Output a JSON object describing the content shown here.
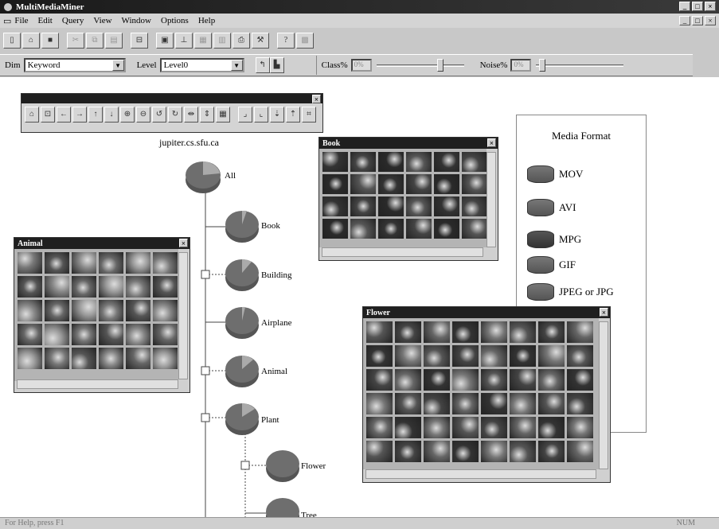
{
  "window": {
    "title": "MultiMediaMiner"
  },
  "menu": [
    "File",
    "Edit",
    "Query",
    "View",
    "Window",
    "Options",
    "Help"
  ],
  "toolbar_icons": [
    "new-icon",
    "open-icon",
    "save-icon",
    "cut-icon",
    "copy-icon",
    "paste-icon",
    "print-preview-icon",
    "frame-icon",
    "align-icon",
    "table-icon",
    "chart-icon",
    "printer-icon",
    "tool-icon",
    "help-icon",
    "grid-icon"
  ],
  "dimbar": {
    "dim_label": "Dim",
    "dim_value": "Keyword",
    "level_label": "Level",
    "level_value": "Level0",
    "class_label": "Class%",
    "class_value": "0%",
    "noise_label": "Noise%",
    "noise_value": "0%"
  },
  "tree": {
    "host": "jupiter.cs.sfu.ca",
    "nodes": [
      "All",
      "Book",
      "Building",
      "Airplane",
      "Animal",
      "Plant",
      "Flower",
      "Tree"
    ]
  },
  "windows": {
    "book": "Book",
    "animal": "Animal",
    "flower": "Flower"
  },
  "legend": {
    "title": "Media Format",
    "items": [
      "MOV",
      "AVI",
      "MPG",
      "GIF",
      "JPEG or JPG"
    ]
  },
  "status": {
    "text": "For Help, press F1",
    "right": "NUM"
  }
}
